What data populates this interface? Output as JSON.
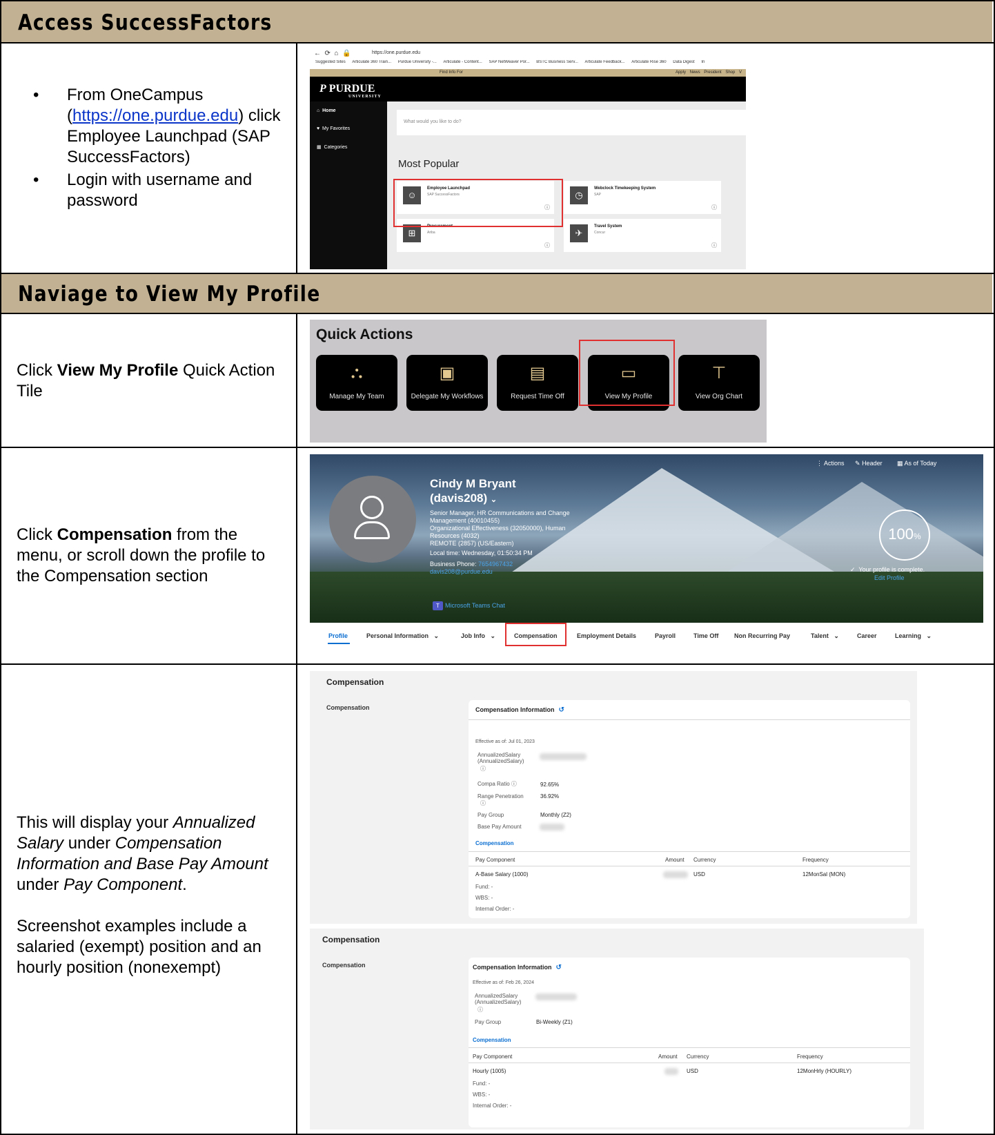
{
  "sections": {
    "access": {
      "title": "Access SuccessFactors"
    },
    "navigate": {
      "title": "Naviage to View My Profile"
    }
  },
  "rows": {
    "step1": {
      "bullet1_prefix": "From OneCampus (",
      "bullet1_link": "https://one.purdue.edu",
      "bullet1_suffix": ") click Employee Launchpad (SAP SuccessFactors)",
      "bullet2": "Login with username and password"
    },
    "step2": {
      "pre": "Click ",
      "bold": "View My Profile",
      "post": " Quick Action Tile"
    },
    "step3": {
      "pre": "Click ",
      "bold": "Compensation",
      "post": " from the menu, or scroll down the profile to the Compensation section"
    },
    "step4": {
      "p1_a": "This will display your ",
      "p1_b": "Annualized Salary",
      "p1_c": " under ",
      "p1_d": "Compensation Information and Base Pay Amount",
      "p1_e": " under ",
      "p1_f": "Pay Component",
      "p1_g": ".",
      "p2": "Screenshot examples include a salaried (exempt) position and an hourly position (nonexempt)"
    }
  },
  "onecampus": {
    "address": "https://one.purdue.edu",
    "bookmarks": [
      "Suggested Sites",
      "Articulate 360 Train...",
      "Purdue University -...",
      "Articulate - Content...",
      "SAP NetWeaver Por...",
      "BSTC Business Serv...",
      "Articulate Feedback...",
      "Articulate Rise 360",
      "Data Digest",
      "In"
    ],
    "find_info": "Find Info For",
    "top_links": "Apply News President Shop V",
    "logo": "PURDUE",
    "logo_sub": "UNIVERSITY",
    "nav": {
      "home": "Home",
      "favorites": "My Favorites",
      "categories": "Categories"
    },
    "search_placeholder": "What would you like to do?",
    "most_popular": "Most Popular",
    "tiles": [
      {
        "title": "Employee Launchpad",
        "sub": "SAP SuccessFactors"
      },
      {
        "title": "Webclock Timekeeping System",
        "sub": "SAP"
      },
      {
        "title": "Procurement",
        "sub": "Ariba"
      },
      {
        "title": "Travel System",
        "sub": "Concur"
      }
    ]
  },
  "quick_actions": {
    "title": "Quick Actions",
    "tiles": [
      "Manage My Team",
      "Delegate My Workflows",
      "Request Time Off",
      "View My Profile",
      "View Org Chart"
    ]
  },
  "profile": {
    "name_line1": "Cindy M Bryant",
    "name_line2": "(davis208)",
    "title": "Senior Manager, HR Communications and Change Management (40010455)",
    "dept": "Organizational Effectiveness (32050000), Human Resources (4032)",
    "location": "REMOTE (2857) (US/Eastern)",
    "local_time": "Local time: Wednesday, 01:50:34 PM",
    "phone_label": "Business Phone:",
    "phone": "7654967432",
    "email": "davis208@purdue.edu",
    "teams": "Microsoft Teams Chat",
    "actions": "Actions",
    "header": "Header",
    "as_of": "As of Today",
    "completion_value": "100",
    "completion_unit": "%",
    "complete_msg": "Your profile is complete.",
    "edit_profile": "Edit Profile",
    "tabs": [
      "Profile",
      "Personal Information",
      "Job Info",
      "Compensation",
      "Employment Details",
      "Payroll",
      "Time Off",
      "Non Recurring Pay",
      "Talent",
      "Career",
      "Learning"
    ]
  },
  "comp_salaried": {
    "title": "Compensation",
    "subtitle": "Compensation",
    "card_title": "Compensation Information",
    "effective": "Effective as of: Jul 01, 2023",
    "annualized_label": "AnnualizedSalary (AnnualizedSalary)",
    "compa_label": "Compa Ratio",
    "compa_value": "92.65%",
    "range_label": "Range Penetration",
    "range_value": "36.92%",
    "pay_group_label": "Pay Group",
    "pay_group_value": "Monthly (Z2)",
    "base_pay_label": "Base Pay Amount",
    "section": "Compensation",
    "col_component": "Pay Component",
    "col_amount": "Amount",
    "col_currency": "Currency",
    "col_frequency": "Frequency",
    "row_component": "A-Base Salary (1000)",
    "row_currency": "USD",
    "row_frequency": "12MonSal (MON)",
    "fund": "Fund: -",
    "wbs": "WBS: -",
    "internal_order": "Internal Order: -"
  },
  "comp_hourly": {
    "title": "Compensation",
    "subtitle": "Compensation",
    "card_title": "Compensation Information",
    "effective": "Effective as of: Feb 26, 2024",
    "annualized_label": "AnnualizedSalary (AnnualizedSalary)",
    "pay_group_label": "Pay Group",
    "pay_group_value": "Bi-Weekly (Z1)",
    "section": "Compensation",
    "col_component": "Pay Component",
    "col_amount": "Amount",
    "col_currency": "Currency",
    "col_frequency": "Frequency",
    "row_component": "Hourly (1005)",
    "row_currency": "USD",
    "row_frequency": "12MonHrly (HOURLY)",
    "fund": "Fund: -",
    "wbs": "WBS: -",
    "internal_order": "Internal Order: -"
  },
  "colors": {
    "section_header": "#c2b192",
    "highlight": "#e03030",
    "link": "#0b35c9",
    "sap_blue": "#0a6ed1"
  }
}
